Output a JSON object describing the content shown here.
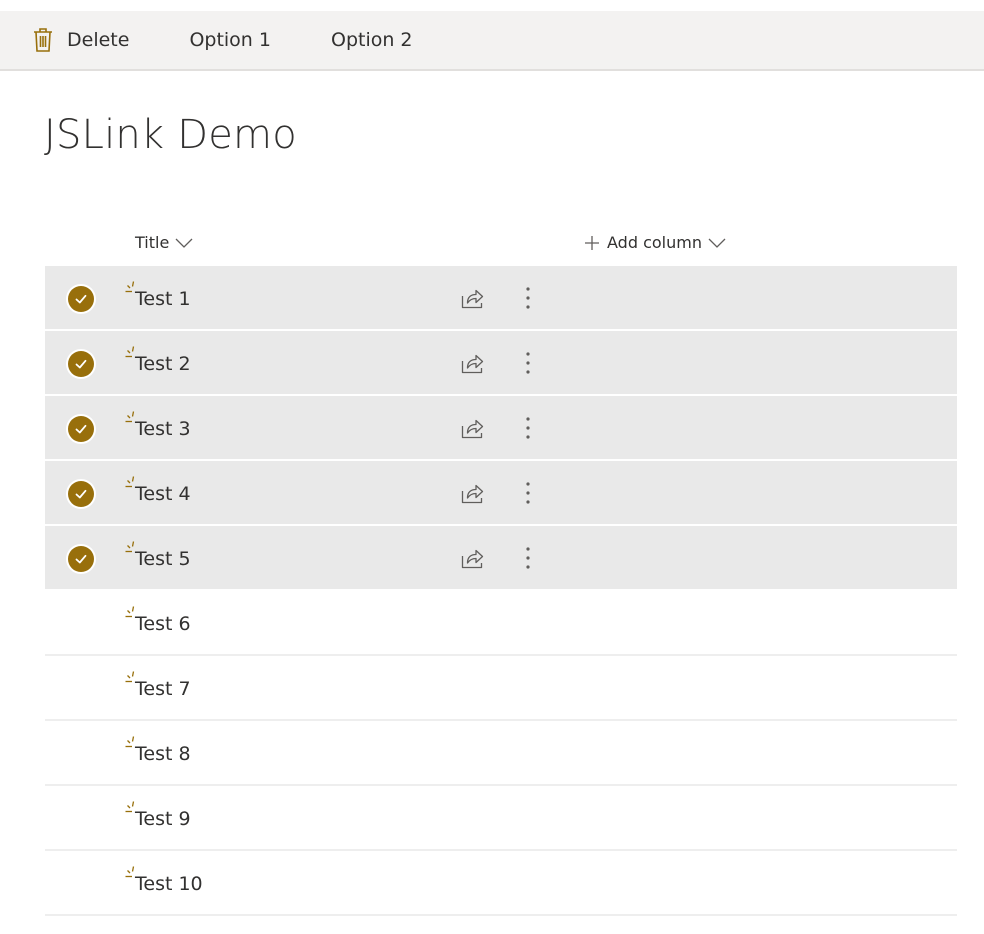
{
  "command_bar": {
    "delete_label": "Delete",
    "option1_label": "Option 1",
    "option2_label": "Option 2",
    "delete_icon": "trash-icon"
  },
  "page": {
    "title": "JSLink Demo"
  },
  "list": {
    "columns": {
      "title_label": "Title",
      "add_column_label": "Add column"
    },
    "accent_color": "#986f0b",
    "selected_row_color": "#e9e9e9",
    "rows": [
      {
        "title": "Test 1",
        "selected": true
      },
      {
        "title": "Test 2",
        "selected": true
      },
      {
        "title": "Test 3",
        "selected": true
      },
      {
        "title": "Test 4",
        "selected": true
      },
      {
        "title": "Test 5",
        "selected": true
      },
      {
        "title": "Test 6",
        "selected": false
      },
      {
        "title": "Test 7",
        "selected": false
      },
      {
        "title": "Test 8",
        "selected": false
      },
      {
        "title": "Test 9",
        "selected": false
      },
      {
        "title": "Test 10",
        "selected": false
      }
    ],
    "row_icons": {
      "new": "new-item-icon",
      "share": "share-icon",
      "more": "more-actions-icon",
      "check": "checkmark-icon"
    }
  }
}
